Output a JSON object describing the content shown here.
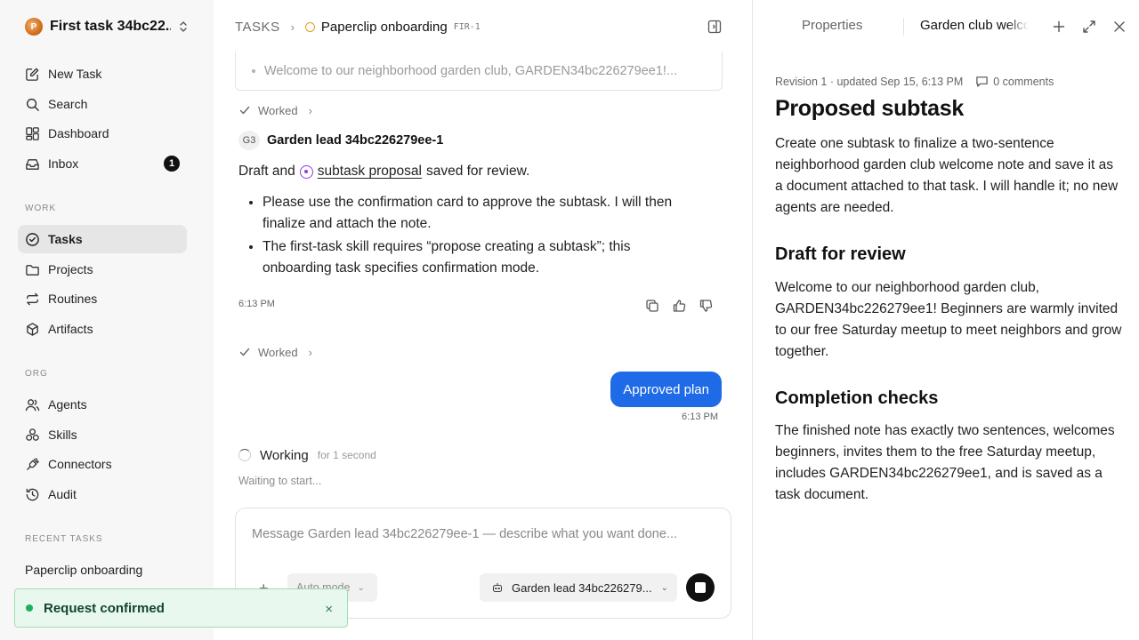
{
  "sidebar": {
    "workspace_name": "First task 34bc22...",
    "nav_top": [
      {
        "label": "New Task",
        "icon": "edit-icon"
      },
      {
        "label": "Search",
        "icon": "search-icon"
      },
      {
        "label": "Dashboard",
        "icon": "dashboard-icon"
      },
      {
        "label": "Inbox",
        "icon": "inbox-icon",
        "badge": "1"
      }
    ],
    "work_label": "WORK",
    "nav_work": [
      {
        "label": "Tasks",
        "icon": "check-circle-icon",
        "active": true
      },
      {
        "label": "Projects",
        "icon": "folder-icon"
      },
      {
        "label": "Routines",
        "icon": "repeat-icon"
      },
      {
        "label": "Artifacts",
        "icon": "cube-icon"
      }
    ],
    "org_label": "ORG",
    "nav_org": [
      {
        "label": "Agents",
        "icon": "users-icon"
      },
      {
        "label": "Skills",
        "icon": "skills-icon"
      },
      {
        "label": "Connectors",
        "icon": "plug-icon"
      },
      {
        "label": "Audit",
        "icon": "history-icon"
      }
    ],
    "recent_label": "RECENT TASKS",
    "recent_tasks": [
      "Paperclip onboarding"
    ]
  },
  "toast": {
    "text": "Request confirmed",
    "close": "×"
  },
  "header": {
    "section": "TASKS",
    "separator": "›",
    "task_title": "Paperclip onboarding",
    "task_code": "FIR-1"
  },
  "thread": {
    "quoted_preview": "Welcome to our neighborhood garden club, GARDEN34bc226279ee1!...",
    "worked_label": "Worked",
    "agent_initials": "G3",
    "agent_name": "Garden lead 34bc226279ee-1",
    "msg_prefix": "Draft and",
    "msg_link": "subtask proposal",
    "msg_suffix": "saved for review.",
    "bullets": [
      "Please use the confirmation card to approve the subtask. I will then finalize and attach the note.",
      "The first-task skill requires “propose creating a subtask”; this onboarding task specifies confirmation mode."
    ],
    "msg_time": "6:13 PM",
    "worked_label_2": "Worked",
    "user_msg": "Approved plan",
    "user_time": "6:13 PM",
    "working_label": "Working",
    "working_duration": "for 1 second",
    "waiting": "Waiting to start..."
  },
  "composer": {
    "placeholder": "Message Garden lead 34bc226279ee-1 — describe what you want done...",
    "plus": "+",
    "mode": "Auto mode",
    "agent": "Garden lead 34bc226279...",
    "chevron": "⌄"
  },
  "right_panel": {
    "tab_properties": "Properties",
    "tab_document": "Garden club welcome",
    "revision": "Revision 1 · updated Sep 15, 6:13 PM",
    "comments": "0 comments",
    "h1": "Proposed subtask",
    "p1": "Create one subtask to finalize a two-sentence neighborhood garden club welcome note and save it as a document attached to that task. I will handle it; no new agents are needed.",
    "h2a": "Draft for review",
    "p2": "Welcome to our neighborhood garden club, GARDEN34bc226279ee1! Beginners are warmly invited to our free Saturday meetup to meet neighbors and grow together.",
    "h2b": "Completion checks",
    "p3": "The finished note has exactly two sentences, welcomes beginners, invites them to the free Saturday meetup, includes GARDEN34bc226279ee1, and is saved as a task document."
  }
}
